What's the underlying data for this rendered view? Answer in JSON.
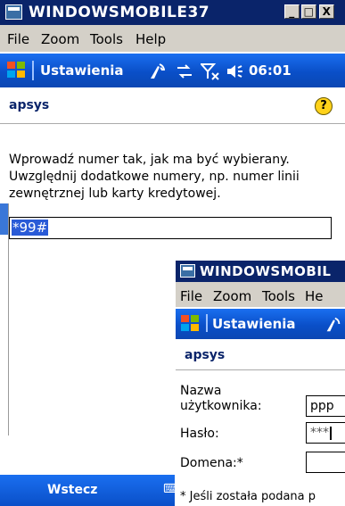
{
  "window1": {
    "title": "WINDOWSMOBILE37",
    "menu": [
      "File",
      "Zoom",
      "Tools",
      "Help"
    ],
    "bar_title": "Ustawienia",
    "time": "06:01",
    "status_icons": [
      "signal-icon",
      "sync-icon",
      "no-antenna-icon",
      "volume-icon"
    ],
    "subtitle": "apsys",
    "instruction": "Wprowadź numer tak, jak ma być wybierany. Uwzględnij dodatkowe numery, np. numer linii zewnętrznej lub karty kredytowej.",
    "dial_number": "*99#",
    "back_label": "Wstecz",
    "title_buttons": [
      "_",
      "□",
      "X"
    ]
  },
  "window2": {
    "title": "WINDOWSMOBIL",
    "menu": [
      "File",
      "Zoom",
      "Tools",
      "He"
    ],
    "bar_title": "Ustawienia",
    "subtitle": "apsys",
    "username_label": "Nazwa użytkownika:",
    "username_value": "ppp",
    "password_label": "Hasło:",
    "password_value": "***",
    "domain_label": "Domena:*",
    "domain_value": "",
    "note": "* Jeśli została podana p"
  },
  "colors": {
    "titlebar": "#0a246a",
    "wm_bar": "#0a4fc8",
    "selection": "#2a5bd7"
  }
}
